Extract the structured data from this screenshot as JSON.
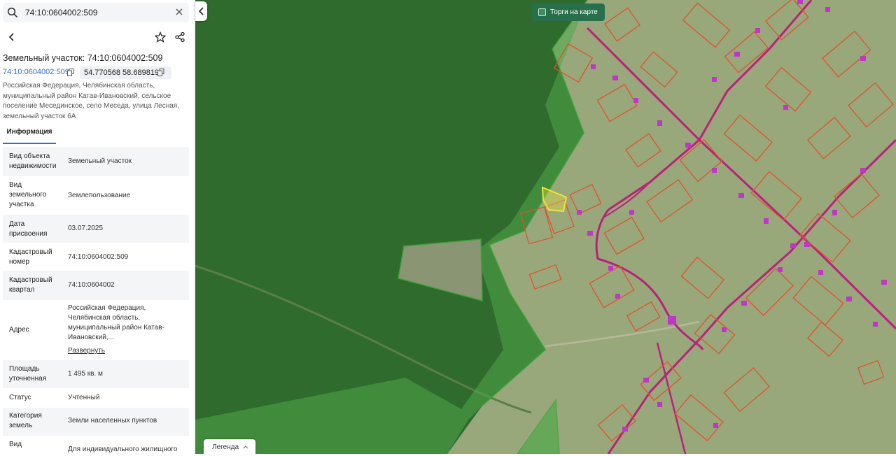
{
  "search": {
    "value": "74:10:0604002:509"
  },
  "header": {
    "title": "Земельный участок: 74:10:0604002:509",
    "cadastral_link": "74:10:0604002:509",
    "coordinates": "54.770568 58.689819",
    "address_full": "Российская Федерация, Челябинская область, муниципальный район Катав-Ивановский, сельское поселение Месединское, село Меседа, улица Лесная, земельный участок 6А"
  },
  "tabs": [
    {
      "label": "Информация",
      "active": true
    }
  ],
  "info": {
    "rows": [
      {
        "label": "Вид объекта недвижимости",
        "value": "Земельный участок"
      },
      {
        "label": "Вид земельного участка",
        "value": "Землепользование"
      },
      {
        "label": "Дата присвоения",
        "value": "03.07.2025"
      },
      {
        "label": "Кадастровый номер",
        "value": "74:10:0604002:509"
      },
      {
        "label": "Кадастровый квартал",
        "value": "74:10:0604002"
      },
      {
        "label": "Адрес",
        "value": "Российская Федерация, Челябинская область, муниципальный район Катав-Ивановский,...",
        "link": "Развернуть"
      },
      {
        "label": "Площадь уточненная",
        "value": "1 495 кв. м"
      },
      {
        "label": "Статус",
        "value": "Учтенный"
      },
      {
        "label": "Категория земель",
        "value": "Земли населенных пунктов"
      },
      {
        "label": "Вид",
        "value": "Для индивидуального жилищного"
      }
    ]
  },
  "map": {
    "auction_toggle": "Торги на карте",
    "legend": "Легенда",
    "colors": {
      "forest": "#2f6b2c",
      "field": "#98a87a",
      "zone_fill": "#4fa84a",
      "parcel_outline": "#e0522e",
      "road": "#b8227a",
      "building": "#c036c8",
      "selected_parcel": "#f2e23a"
    }
  },
  "icons": [
    "search-icon",
    "close-icon",
    "back-arrow-icon",
    "star-icon",
    "share-icon",
    "copy-icon",
    "chevron-left-icon",
    "chevron-up-icon",
    "checkbox-icon"
  ]
}
